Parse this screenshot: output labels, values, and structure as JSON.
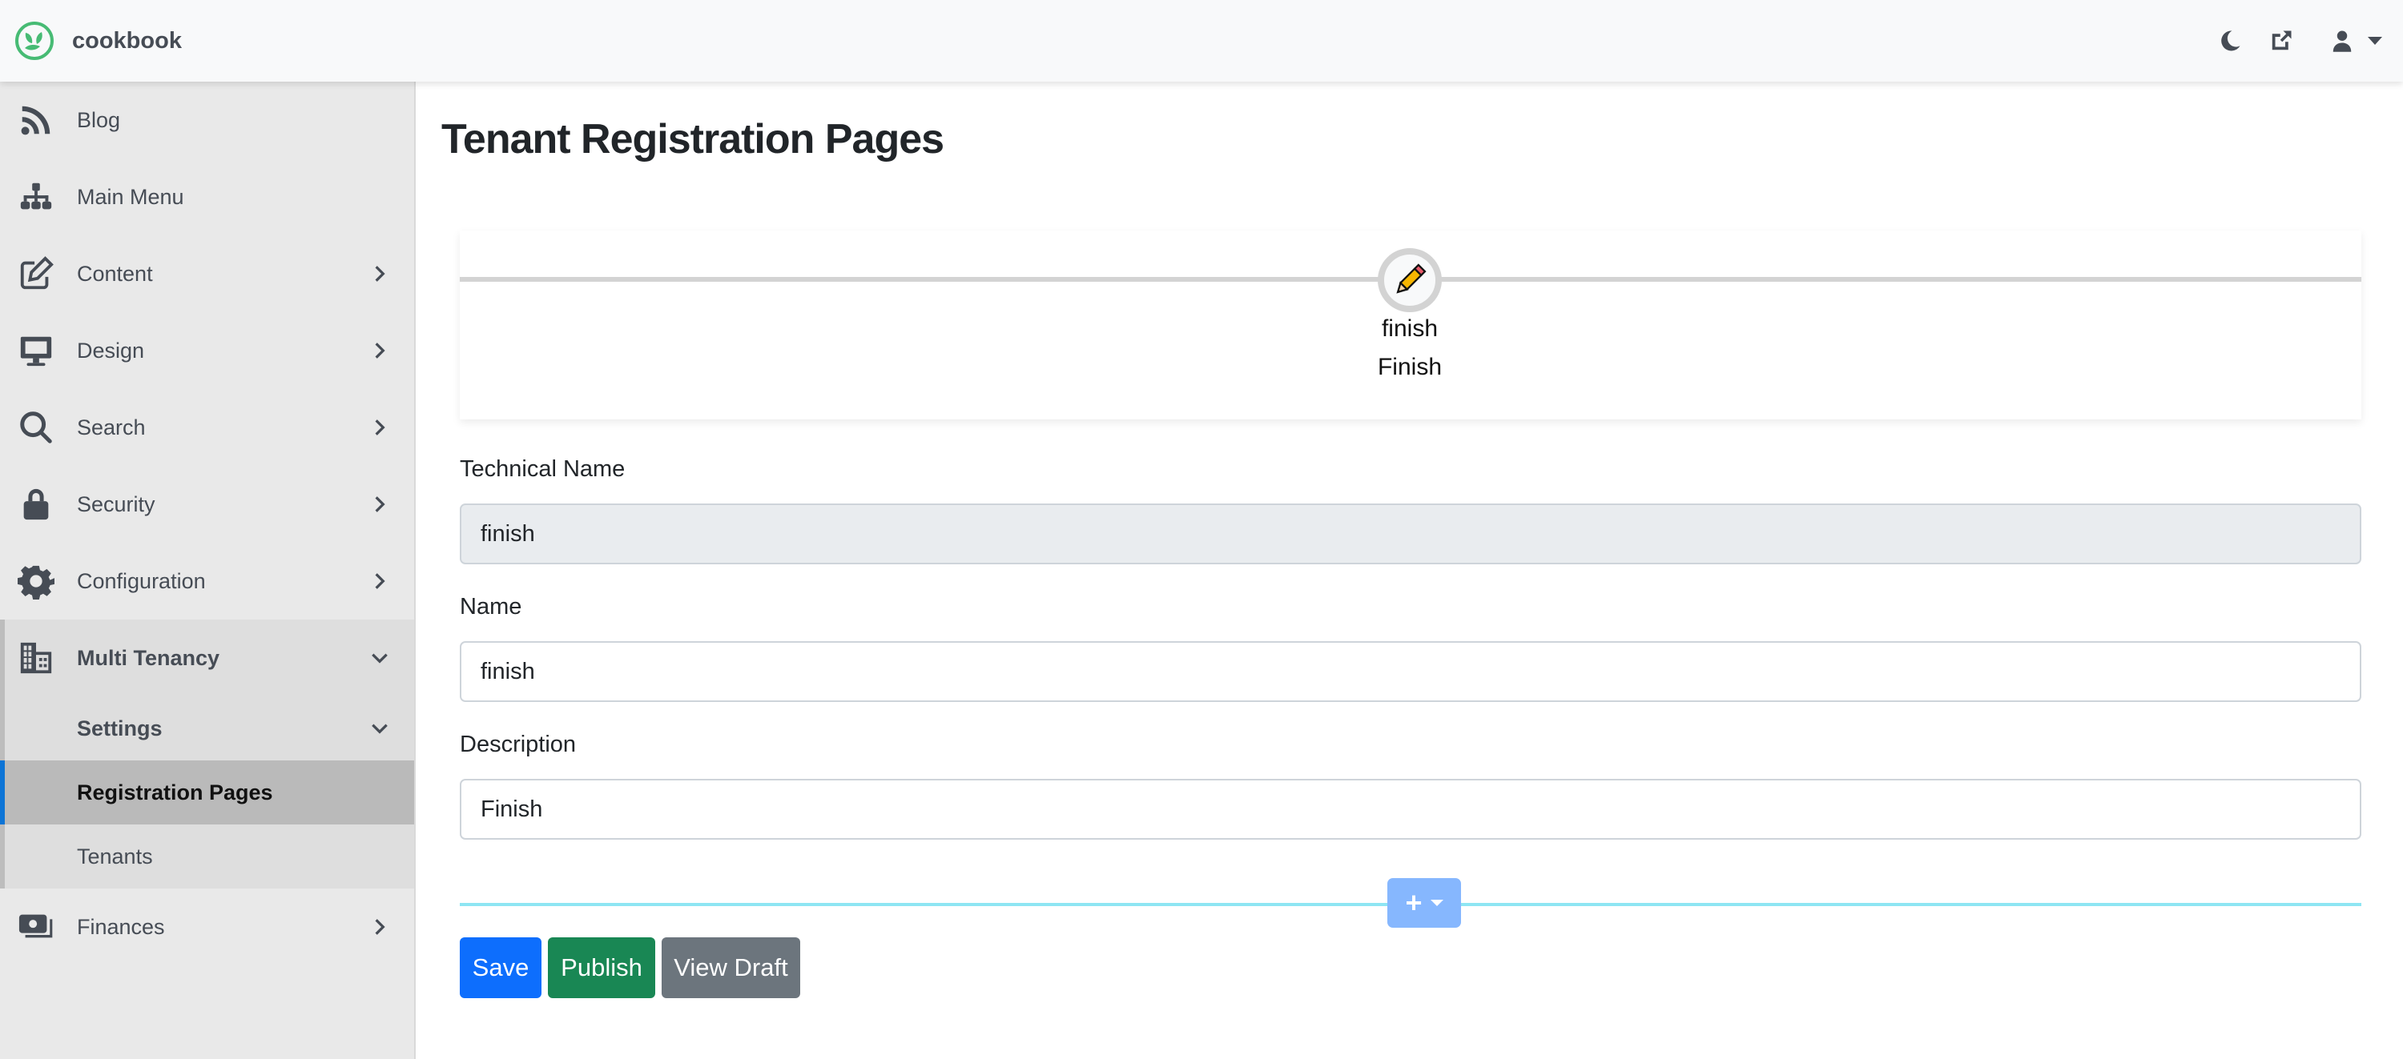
{
  "app": {
    "brand_name": "cookbook",
    "brand_color": "#47bb74"
  },
  "topbar": {
    "icons": [
      "moon-icon",
      "external-link-icon",
      "user-icon"
    ]
  },
  "sidebar": {
    "items": [
      {
        "label": "Blog",
        "icon": "rss-icon",
        "has_chevron": false
      },
      {
        "label": "Main Menu",
        "icon": "sitemap-icon",
        "has_chevron": false
      },
      {
        "label": "Content",
        "icon": "edit-icon",
        "has_chevron": true
      },
      {
        "label": "Design",
        "icon": "desktop-icon",
        "has_chevron": true
      },
      {
        "label": "Search",
        "icon": "search-icon",
        "has_chevron": true
      },
      {
        "label": "Security",
        "icon": "lock-icon",
        "has_chevron": true
      },
      {
        "label": "Configuration",
        "icon": "gear-icon",
        "has_chevron": true
      },
      {
        "label": "Multi Tenancy",
        "icon": "building-icon",
        "expanded": true,
        "children": [
          {
            "label": "Settings",
            "expanded": true
          },
          {
            "label": "Registration Pages",
            "active": true
          },
          {
            "label": "Tenants"
          }
        ]
      },
      {
        "label": "Finances",
        "icon": "money-icon",
        "has_chevron": true
      }
    ],
    "active_accent": "#0d74d6"
  },
  "main": {
    "title": "Tenant Registration Pages",
    "stepper": {
      "steps": [
        {
          "name": "finish",
          "description": "Finish",
          "icon": "pencil-icon"
        }
      ]
    },
    "form": {
      "technical_name": {
        "label": "Technical Name",
        "value": "finish",
        "disabled": true
      },
      "name": {
        "label": "Name",
        "value": "finish"
      },
      "description": {
        "label": "Description",
        "value": "Finish"
      }
    },
    "add_button": {
      "label": "+"
    },
    "buttons": {
      "save": "Save",
      "publish": "Publish",
      "view_draft": "View Draft"
    },
    "colors": {
      "save": "#0d6efd",
      "publish": "#198754",
      "view_draft": "#6c757d",
      "add": "#86b7fe",
      "divider": "#8ee6f3"
    }
  }
}
